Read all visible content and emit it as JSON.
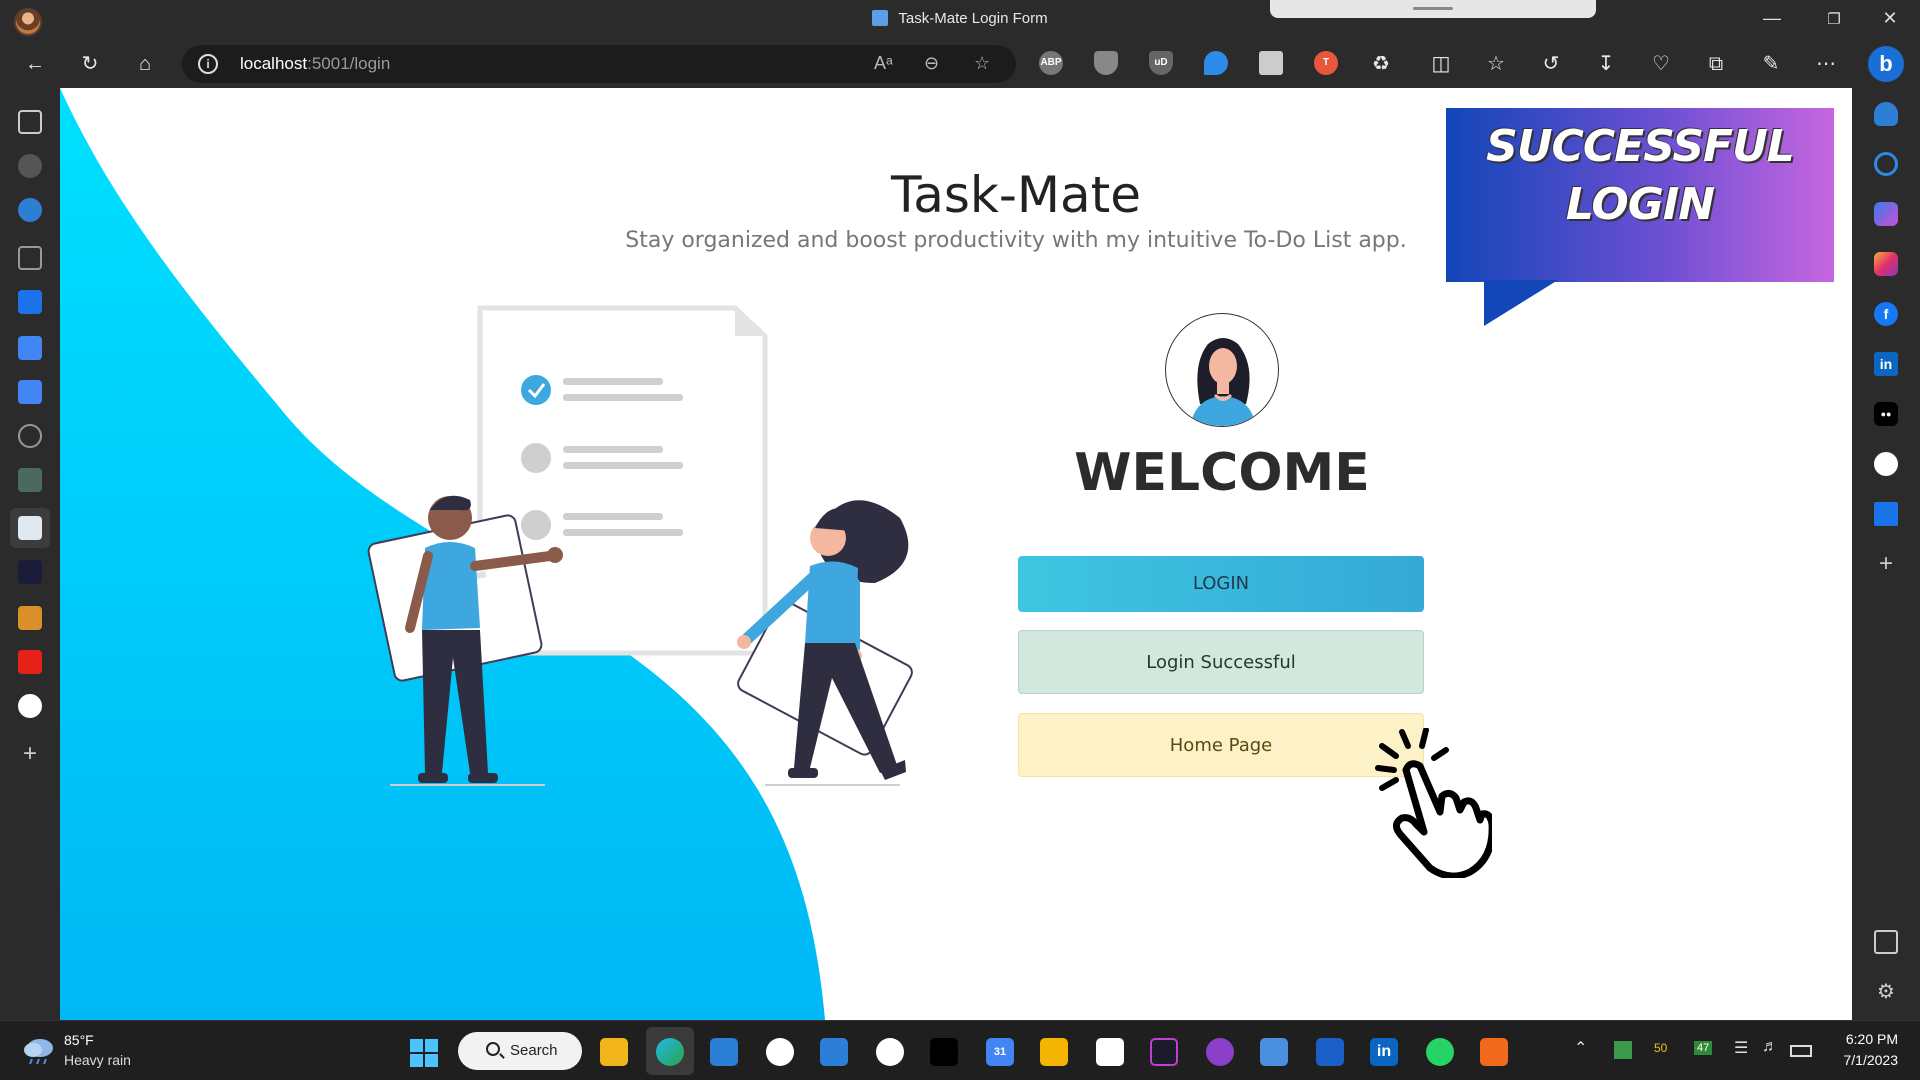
{
  "browser": {
    "window_title": "Task-Mate Login Form",
    "url_host": "localhost",
    "url_rest": ":5001/login",
    "toolbar_icons": [
      "back-icon",
      "refresh-icon",
      "home-icon",
      "read-aloud-icon",
      "zoom-out-icon",
      "favorite-star-icon",
      "adblock-icon",
      "shield-icon",
      "ublock-icon",
      "extension-icon",
      "split-screen-icon",
      "favorites-icon",
      "history-icon",
      "downloads-icon",
      "health-icon",
      "collections-icon",
      "share-icon",
      "more-icon"
    ],
    "ext_abp": "ABP",
    "ext_ublock": "uD",
    "bing_label": "b"
  },
  "page": {
    "title": "Task-Mate",
    "subtitle": "Stay organized and boost productivity with my intuitive To-Do List app.",
    "welcome": "WELCOME",
    "buttons": {
      "login": "LOGIN",
      "login_successful": "Login Successful",
      "home_page": "Home Page"
    },
    "badge": {
      "line1": "SUCCESSFUL",
      "line2": "LOGIN"
    },
    "colors": {
      "accent": "#00c8f0",
      "login_button": "#35a9d7",
      "success_button": "#d2e7dd",
      "home_button": "#fdf1c8",
      "badge_gradient": [
        "#1346b8",
        "#c766e0"
      ]
    }
  },
  "sidebar_right": {
    "items": [
      "bell-icon",
      "search-icon",
      "copilot-icon",
      "instagram-icon",
      "facebook-icon",
      "linkedin-icon",
      "medium-icon",
      "github-icon",
      "trello-icon",
      "add-icon"
    ],
    "linkedin": "in",
    "facebook": "f",
    "medium": "●●"
  },
  "taskbar": {
    "weather_temp": "85°F",
    "weather_desc": "Heavy rain",
    "search_label": "Search",
    "calendar_badge": "31",
    "linkedin_badge": "in",
    "tray_badge_1": "50",
    "tray_badge_2": "47",
    "time": "6:20 PM",
    "date": "7/1/2023"
  }
}
